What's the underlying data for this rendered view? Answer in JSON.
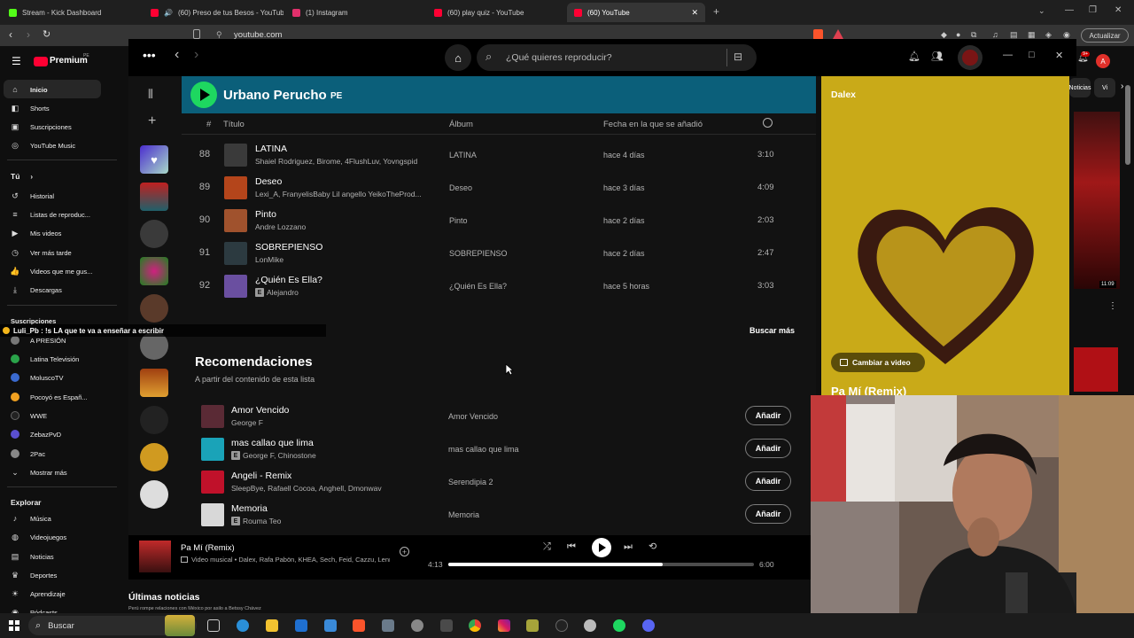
{
  "browser": {
    "tabs": [
      {
        "title": "Stream - Kick Dashboard",
        "color": "#53fc18"
      },
      {
        "title": "(60) Preso de tus Besos - YouTube",
        "color": "#ff0033"
      },
      {
        "title": "(1) Instagram",
        "color": "#e1306c"
      },
      {
        "title": "(60) play quiz - YouTube",
        "color": "#ff0033"
      },
      {
        "title": "(60) YouTube",
        "color": "#ff0033"
      }
    ],
    "url": "youtube.com",
    "update_label": "Actualizar",
    "profile_initial": "A"
  },
  "youtube": {
    "logo": "Premium",
    "logo_suffix": "PE",
    "main_items": [
      "Inicio",
      "Shorts",
      "Suscripciones",
      "YouTube Music"
    ],
    "you_header": "Tú",
    "you_items": [
      "Historial",
      "Listas de reproduc...",
      "Mis videos",
      "Ver más tarde",
      "Videos que me gus...",
      "Descargas"
    ],
    "subs_header": "Suscripciones",
    "subs_items": [
      "A PRESIÓN",
      "Latina Televisión",
      "MoluscoTV",
      "Pocoyó es Españ...",
      "WWE",
      "ZebazPvD",
      "2Pac"
    ],
    "show_more": "Mostrar más",
    "explore_header": "Explorar",
    "explore_items": [
      "Música",
      "Videojuegos",
      "Noticias",
      "Deportes",
      "Aprendizaje",
      "Pódcasts"
    ],
    "news_header": "Últimas noticias",
    "news_sub": "Perú rompe relaciones con México por asilo a Betssy Chávez",
    "chips": [
      "Noticias",
      "Vi"
    ],
    "video_duration": "11:09",
    "notif_count": "9+"
  },
  "chat_overlay": "Luli_Pb : !s LA que te va a enseñar a escribir",
  "spotify": {
    "search_placeholder": "¿Qué quieres reproducir?",
    "playlist_title": "Urbano Perucho",
    "playlist_suffix": "PE",
    "columns": {
      "num": "#",
      "title": "Título",
      "album": "Álbum",
      "date": "Fecha en la que se añadió"
    },
    "tracks": [
      {
        "num": "88",
        "title": "LATINA",
        "artists": "Shaiel Rodriguez, Birome, 4FlushLuv, Yovngspid",
        "explicit": false,
        "album": "LATINA",
        "added": "hace 4 días",
        "duration": "3:10",
        "color": "#3a3a3a"
      },
      {
        "num": "89",
        "title": "Deseo",
        "artists": "Lexi_A, FranyelisBaby Lil angello YeikoTheProd...",
        "explicit": false,
        "album": "Deseo",
        "added": "hace 3 días",
        "duration": "4:09",
        "color": "#b4451b"
      },
      {
        "num": "90",
        "title": "Pinto",
        "artists": "Andre Lozzano",
        "explicit": false,
        "album": "Pinto",
        "added": "hace 2 días",
        "duration": "2:03",
        "color": "#a0522d"
      },
      {
        "num": "91",
        "title": "SOBREPIENSO",
        "artists": "LonMike",
        "explicit": false,
        "album": "SOBREPIENSO",
        "added": "hace 2 días",
        "duration": "2:47",
        "color": "#2c3a40"
      },
      {
        "num": "92",
        "title": "¿Quién Es Ella?",
        "artists": "Alejandro",
        "explicit": true,
        "album": "¿Quién Es Ella?",
        "added": "hace 5 horas",
        "duration": "3:03",
        "color": "#6a4fa0"
      }
    ],
    "find_more": "Buscar más",
    "rec_title": "Recomendaciones",
    "rec_sub": "A partir del contenido de esta lista",
    "recommendations": [
      {
        "title": "Amor Vencido",
        "artists": "George F",
        "explicit": false,
        "album": "Amor Vencido",
        "color": "#5a2a35"
      },
      {
        "title": "mas callao que lima",
        "artists": "George F, Chinostone",
        "explicit": true,
        "album": "mas callao que lima",
        "color": "#1aa3b8"
      },
      {
        "title": "Angeli - Remix",
        "artists": "SleepBye, Rafaell Cocoa, Anghell, Dmonwav",
        "explicit": false,
        "album": "Serendipia 2",
        "color": "#c0112a"
      },
      {
        "title": "Memoria",
        "artists": "Rouma Teo",
        "explicit": true,
        "album": "Memoria",
        "color": "#d8d8d8"
      }
    ],
    "add_label": "Añadir",
    "now_playing": {
      "title": "Pa Mí (Remix)",
      "subtitle": "Video musical • Dalex, Rafa Pabön, KHEA, Sech, Feid, Cazzu, Lenny Tavárez",
      "elapsed": "4:13",
      "total": "6:00",
      "progress": 0.7
    },
    "right_panel": {
      "artist": "Dalex",
      "switch_label": "Cambiar a video",
      "song_title": "Pa Mí (Remix)",
      "bg_color": "#c9aa18"
    },
    "accent": "#1ed760"
  },
  "taskbar": {
    "search_label": "Buscar"
  }
}
